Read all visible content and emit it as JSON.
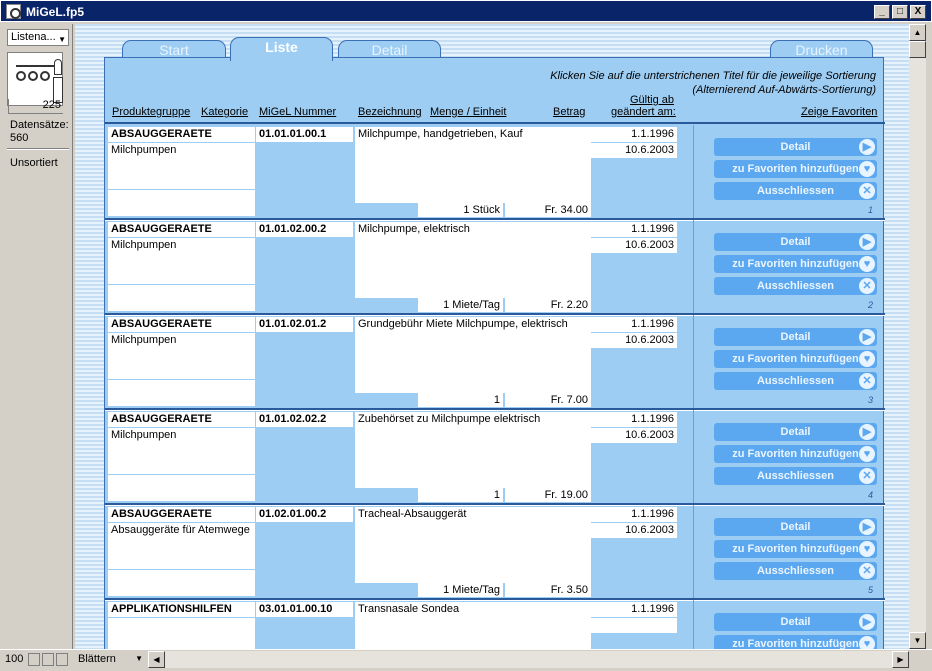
{
  "window": {
    "title": "MiGeL.fp5",
    "min": "_",
    "max": "□",
    "close": "X"
  },
  "status": {
    "layout": "Listena...",
    "page": "225",
    "records_label": "Datensätze:",
    "records_value": "560",
    "sort_state": "Unsortiert"
  },
  "tabs": {
    "start": "Start",
    "liste": "Liste",
    "detail": "Detail",
    "drucken": "Drucken"
  },
  "hints": {
    "line1": "Klicken Sie auf die unterstrichenen Titel für die jeweilige Sortierung",
    "line2": "(Alternierend Auf-Abwärts-Sortierung)"
  },
  "columns": {
    "produktegruppe": "Produktegruppe",
    "kategorie": "Kategorie",
    "migel_nummer": "MiGeL Nummer",
    "bezeichnung": "Bezeichnung",
    "menge_einheit": "Menge / Einheit",
    "betrag": "Betrag",
    "gueltig_line1": "Gültig ab",
    "gueltig_line2": "geändert am:",
    "favoriten": "Zeige Favoriten"
  },
  "buttons": {
    "detail": "Detail",
    "favorit": "zu Favoriten hinzufügen",
    "ausschliessen": "Ausschliessen"
  },
  "records": [
    {
      "gruppe": "ABSAUGGERAETE",
      "kategorie": "Milchpumpen",
      "nummer": "01.01.01.00.1",
      "bezeichnung": "Milchpumpe, handgetrieben, Kauf",
      "menge": "1 Stück",
      "betrag": "Fr. 34.00",
      "gueltig": "1.1.1996",
      "geaendert": "10.6.2003",
      "nr": "1"
    },
    {
      "gruppe": "ABSAUGGERAETE",
      "kategorie": "Milchpumpen",
      "nummer": "01.01.02.00.2",
      "bezeichnung": "Milchpumpe, elektrisch",
      "menge": "1 Miete/Tag",
      "betrag": "Fr. 2.20",
      "gueltig": "1.1.1996",
      "geaendert": "10.6.2003",
      "nr": "2"
    },
    {
      "gruppe": "ABSAUGGERAETE",
      "kategorie": "Milchpumpen",
      "nummer": "01.01.02.01.2",
      "bezeichnung": "Grundgebühr Miete Milchpumpe, elektrisch",
      "menge": "1",
      "betrag": "Fr. 7.00",
      "gueltig": "1.1.1996",
      "geaendert": "10.6.2003",
      "nr": "3"
    },
    {
      "gruppe": "ABSAUGGERAETE",
      "kategorie": "Milchpumpen",
      "nummer": "01.01.02.02.2",
      "bezeichnung": "Zubehörset zu Milchpumpe elektrisch",
      "menge": "1",
      "betrag": "Fr. 19.00",
      "gueltig": "1.1.1996",
      "geaendert": "10.6.2003",
      "nr": "4"
    },
    {
      "gruppe": "ABSAUGGERAETE",
      "kategorie": "Absauggeräte für Atemwege",
      "nummer": "01.02.01.00.2",
      "bezeichnung": "Tracheal-Absauggerät",
      "menge": "1 Miete/Tag",
      "betrag": "Fr. 3.50",
      "gueltig": "1.1.1996",
      "geaendert": "10.6.2003",
      "nr": "5"
    },
    {
      "gruppe": "APPLIKATIONSHILFEN",
      "kategorie": "",
      "nummer": "03.01.01.00.10",
      "bezeichnung": "Transnasale Sondea",
      "menge": "",
      "betrag": "",
      "gueltig": "1.1.1996",
      "geaendert": "",
      "nr": ""
    }
  ],
  "bottom": {
    "zoom": "100",
    "mode": "Blättern"
  }
}
